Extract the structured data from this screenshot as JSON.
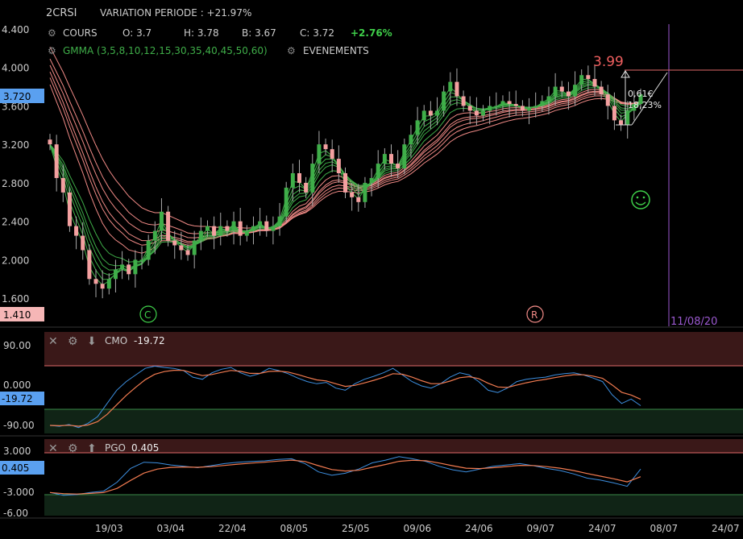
{
  "header": {
    "symbol": "2CRSI",
    "variation": "VARIATION PERIODE : +21.97%"
  },
  "main_legend": {
    "cours_label": "COURS",
    "open": "O: 3.7",
    "high": "H: 3.78",
    "low": "B: 3.67",
    "close": "C: 3.72",
    "change": "+2.76%",
    "gmma_label": "GMMA (3,5,8,10,12,15,30,35,40,45,50,60)",
    "events_label": "EVENEMENTS"
  },
  "price_badges": {
    "current": "3.720",
    "low_marker": "1.410"
  },
  "annotations": {
    "target_price": "3.99",
    "measure_value": "0,61€",
    "measure_pct": "18,23%",
    "date_marker": "11/08/20",
    "event_c": "C",
    "event_r": "R",
    "smiley": "☺"
  },
  "colors": {
    "background": "#000000",
    "bull": "#3fae49",
    "bear": "#f4a0a0",
    "short_mas": "#3fae49",
    "long_mas": "#f08a86",
    "cmo_line": "#3d8fe0",
    "signal_line": "#f07a50",
    "overbought_zone": "#3a1818",
    "oversold_zone": "#102416",
    "current_badge": "#5aa0f0",
    "low_badge": "#f6b6b6",
    "date_line": "#9b59d0",
    "change_up": "#3fcf4a"
  },
  "cmo_panel": {
    "name": "CMO",
    "value": "-19.72",
    "badge": "-19.72",
    "ticks": [
      "90.00",
      "0.000",
      "-90.00"
    ]
  },
  "pgo_panel": {
    "name": "PGO",
    "value": "0.405",
    "badge": "0.405",
    "ticks": [
      "3.000",
      "-3.000",
      "-6.00"
    ]
  },
  "chart_data": {
    "type": "candlestick",
    "y_ticks": [
      "4.400",
      "4.000",
      "3.600",
      "3.200",
      "2.800",
      "2.400",
      "2.000",
      "1.600"
    ],
    "ylim": [
      1.35,
      4.45
    ],
    "x_ticks": [
      "19/03",
      "03/04",
      "22/04",
      "08/05",
      "25/05",
      "09/06",
      "24/06",
      "09/07",
      "24/07",
      "08/07",
      "24/07"
    ],
    "close_prices": [
      3.2,
      2.85,
      2.7,
      2.35,
      2.25,
      2.1,
      1.8,
      1.75,
      1.7,
      1.8,
      1.9,
      1.95,
      1.85,
      2.0,
      2.0,
      2.2,
      2.3,
      2.5,
      2.2,
      2.15,
      2.1,
      2.05,
      2.2,
      2.3,
      2.35,
      2.25,
      2.35,
      2.3,
      2.4,
      2.25,
      2.3,
      2.35,
      2.4,
      2.3,
      2.35,
      2.45,
      2.75,
      2.9,
      2.8,
      2.7,
      3.0,
      3.2,
      3.15,
      3.05,
      2.9,
      2.7,
      2.65,
      2.6,
      2.8,
      2.85,
      3.0,
      3.1,
      3.0,
      2.95,
      3.2,
      3.3,
      3.45,
      3.55,
      3.5,
      3.55,
      3.75,
      3.85,
      3.7,
      3.6,
      3.55,
      3.5,
      3.55,
      3.6,
      3.6,
      3.65,
      3.62,
      3.6,
      3.55,
      3.58,
      3.6,
      3.65,
      3.7,
      3.8,
      3.75,
      3.7,
      3.82,
      3.92,
      3.88,
      3.8,
      3.72,
      3.6,
      3.45,
      3.4,
      3.55,
      3.62,
      3.72
    ],
    "cmo_values": [
      -90,
      -92,
      -88,
      -95,
      -85,
      -70,
      -40,
      -10,
      10,
      25,
      40,
      45,
      42,
      40,
      35,
      20,
      15,
      30,
      38,
      42,
      30,
      22,
      28,
      40,
      35,
      28,
      18,
      10,
      5,
      8,
      -5,
      -10,
      5,
      15,
      22,
      30,
      40,
      25,
      10,
      0,
      -5,
      5,
      20,
      30,
      25,
      10,
      -10,
      -15,
      -5,
      10,
      15,
      18,
      20,
      25,
      28,
      30,
      25,
      18,
      10,
      -20,
      -40,
      -30,
      -45
    ],
    "pgo_values": [
      -3.0,
      -3.4,
      -3.3,
      -3.0,
      -2.8,
      -1.5,
      0.5,
      1.4,
      1.3,
      1.0,
      0.8,
      0.6,
      0.9,
      1.2,
      1.4,
      1.5,
      1.6,
      1.8,
      1.9,
      1.2,
      0.0,
      -0.5,
      -0.2,
      0.4,
      1.3,
      1.7,
      2.2,
      1.9,
      1.5,
      0.8,
      0.3,
      0.0,
      0.4,
      0.8,
      1.0,
      1.2,
      0.9,
      0.5,
      0.2,
      -0.3,
      -0.9,
      -1.2,
      -1.6,
      -2.1,
      0.405
    ]
  }
}
